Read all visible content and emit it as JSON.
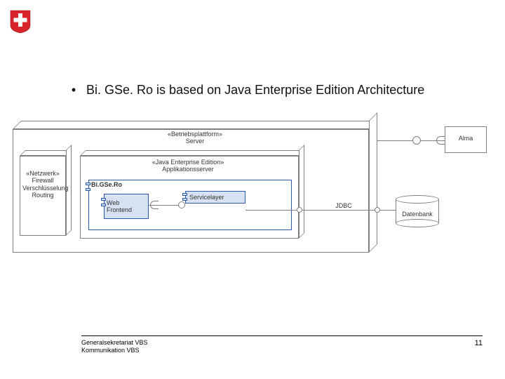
{
  "bullet_text": "Bi. GSe. Ro is based on Java Enterprise Edition Architecture",
  "diagram": {
    "platform_label": "«Betriebsplattform»\nServer",
    "netzwerk_label": "«Netzwerk»\nFirewall\nVerschlüsselung\nRouting",
    "appserver_label": "«Java Enterprise Edition»\nApplikationsserver",
    "app_inner_label": "Bi.GSe.Ro",
    "web_frontend_label": "Web\nFrontend",
    "servicelayer_label": "Servicelayer",
    "jdbc_label": "JDBC",
    "db_label": "Datenbank",
    "alma_label": "Alma"
  },
  "footer": {
    "line1": "Generalsekretariat VBS",
    "line2": "Kommunikation VBS",
    "page_number": "11"
  }
}
